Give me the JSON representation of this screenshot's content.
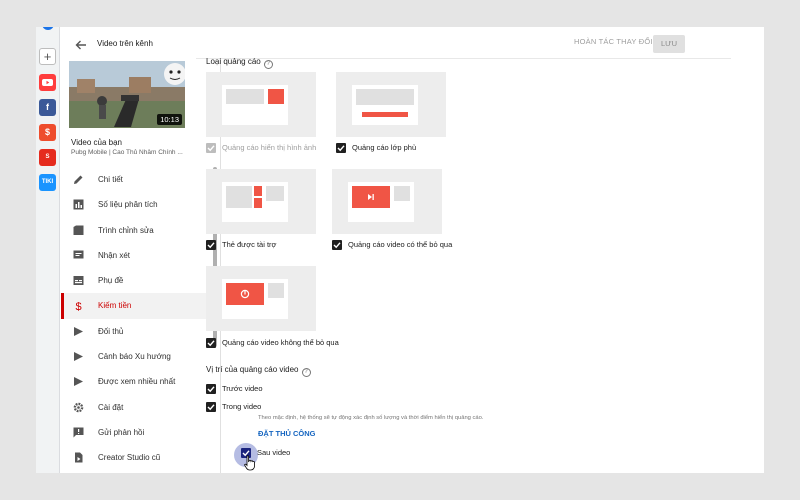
{
  "nav": {
    "title": "Video trên kênh",
    "video_title": "Video của bạn",
    "video_subtitle": "Pubg Mobile | Cao Thủ Nhâm Chính ...",
    "duration": "10:13",
    "items": [
      {
        "label": "Chi tiết",
        "icon": "pencil-icon"
      },
      {
        "label": "Số liệu phân tích",
        "icon": "bar-chart-icon"
      },
      {
        "label": "Trình chỉnh sửa",
        "icon": "film-icon"
      },
      {
        "label": "Nhận xét",
        "icon": "comment-icon"
      },
      {
        "label": "Phụ đề",
        "icon": "subtitles-icon"
      },
      {
        "label": "Kiếm tiền",
        "icon": "dollar-icon",
        "active": true
      },
      {
        "label": "Đối thủ",
        "icon": "play-icon"
      },
      {
        "label": "Cảnh báo Xu hướng",
        "icon": "play-icon"
      },
      {
        "label": "Được xem nhiều nhất",
        "icon": "play-icon"
      },
      {
        "label": "Cài đặt",
        "icon": "gear-icon"
      },
      {
        "label": "Gửi phản hồi",
        "icon": "feedback-icon"
      },
      {
        "label": "Creator Studio cũ",
        "icon": "studio-icon"
      }
    ]
  },
  "topbar": {
    "undo_label": "HOÀN TÁC THAY ĐỔI",
    "save_label": "LƯU"
  },
  "ad_types": {
    "title": "Loại quảng cáo",
    "options": [
      {
        "label": "Quảng cáo hiển thị hình ảnh",
        "checked": true,
        "disabled": true
      },
      {
        "label": "Quảng cáo lớp phủ",
        "checked": true
      },
      {
        "label": "Thẻ được tài trợ",
        "checked": true
      },
      {
        "label": "Quảng cáo video có thể bỏ qua",
        "checked": true
      },
      {
        "label": "Quảng cáo video không thể bỏ qua",
        "checked": true
      }
    ]
  },
  "ad_positions": {
    "title": "Vị trí của quảng cáo video",
    "options": [
      {
        "label": "Trước video",
        "checked": true
      },
      {
        "label": "Trong video",
        "checked": true
      },
      {
        "label": "Sau video",
        "checked": true
      }
    ],
    "hint": "Theo mặc định, hệ thống sẽ tự động xác định số lượng và thời điểm hiển thị quảng cáo.",
    "manual_link": "ĐẶT THỦ CÔNG"
  },
  "rail": {
    "apps": [
      "youtube-icon",
      "facebook-icon",
      "shopee-icon",
      "sendo-icon",
      "tiki-icon"
    ],
    "tiki_text": "TIKI"
  },
  "colors": {
    "accent_red": "#f05545",
    "active_nav": "#cc0000",
    "link_blue": "#1565c0"
  }
}
